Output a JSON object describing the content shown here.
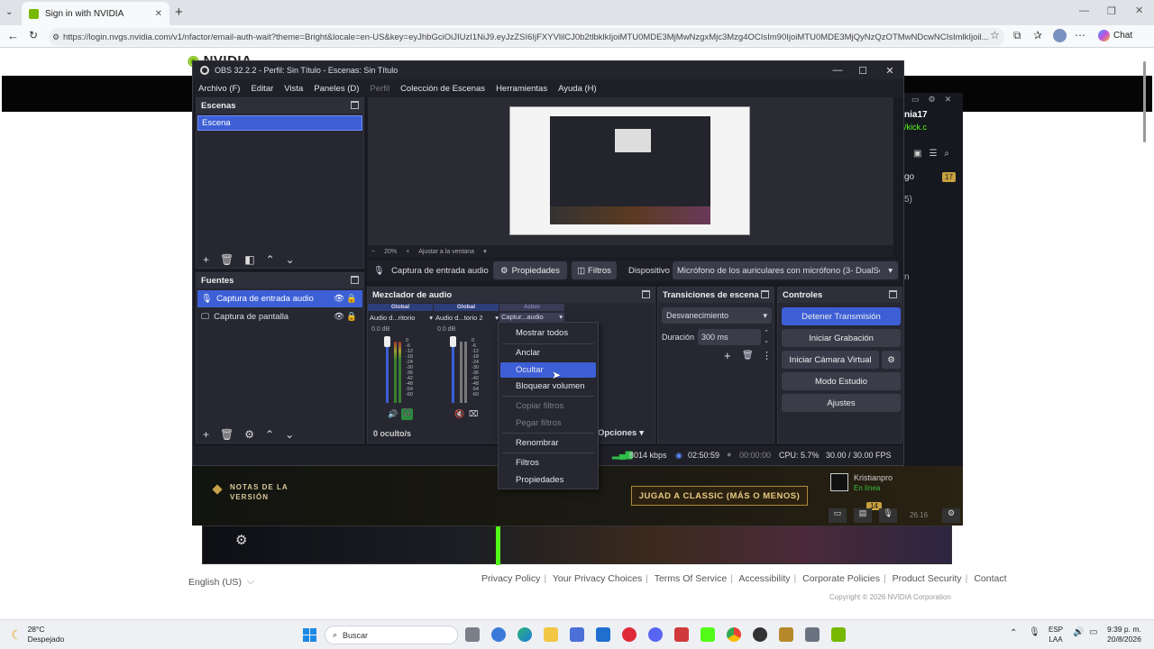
{
  "browser": {
    "tab_title": "Sign in with NVIDIA",
    "url": "https://login.nvgs.nvidia.com/v1/nfactor/email-auth-wait?theme=Bright&locale=en-US&key=eyJhbGciOiJIUzI1NiJ9.eyJzZSI6IjFXYVlilCJ0b2tlbklkIjoiMTU0MDE3MjMwNzgxMjc3Mzg4OCIsIm90IjoiMTU0MDE3MjQyNzQzOTMwNDcwNCIsImlkIjoil...",
    "chat_label": "Chat",
    "accent": "#76b900"
  },
  "page": {
    "logo_text": "NVIDIA",
    "side_user": "nia17",
    "side_link": "/kick.c",
    "side_go": "go",
    "side_badge": "17",
    "side_num": "5)",
    "side_n": "n",
    "game_notes": "NOTAS DE LA VERSIÓN",
    "game_cta": "JUGAD A CLASSIC (MÁS O MENOS)",
    "friend_name": "Kristianpro",
    "friend_status": "En línea",
    "friend_badge": "14",
    "friend_time": "26.16",
    "language": "English (US)",
    "footer_links": [
      "Privacy Policy",
      "Your Privacy Choices",
      "Terms Of Service",
      "Accessibility",
      "Corporate Policies",
      "Product Security",
      "Contact"
    ],
    "copyright": "Copyright © 2026 NVIDIA Corporation"
  },
  "obs": {
    "title": "OBS 32.2.2 - Perfil: Sin Título - Escenas: Sin Título",
    "menu": [
      "Archivo (F)",
      "Editar",
      "Vista",
      "Paneles (D)",
      "Perfil",
      "Colección de Escenas",
      "Herramientas",
      "Ayuda (H)"
    ],
    "scenes_header": "Escenas",
    "scene_item": "Escena",
    "sources_header": "Fuentes",
    "sources": [
      "Captura de entrada audio",
      "Captura de pantalla"
    ],
    "zoom": "20%",
    "fit_label": "Ajustar a la ventana",
    "source_toolbar": {
      "name": "Captura de entrada audio",
      "props": "Propiedades",
      "filters": "Filtros",
      "device_label": "Dispositivo",
      "device_value": "Micrófono de los auriculares con micrófono (3- DualSense"
    },
    "mixer": {
      "header": "Mezclador de audio",
      "tags": [
        "Global",
        "Global",
        "Activo"
      ],
      "channels": [
        "Audio d...ritorio",
        "Audio d...torio 2",
        "Captur...audio"
      ],
      "db": [
        "0.0 dB",
        "0.0 dB"
      ],
      "scale": [
        "0",
        "-6",
        "-12",
        "-18",
        "-24",
        "-30",
        "-36",
        "-42",
        "-48",
        "-54",
        "-60"
      ],
      "hidden": "0 oculto/s",
      "options": "Opciones"
    },
    "transitions": {
      "header": "Transiciones de escena",
      "type": "Desvanecimiento",
      "duration_label": "Duración",
      "duration_value": "300 ms"
    },
    "controls": {
      "header": "Controles",
      "buttons": [
        "Detener Transmisión",
        "Iniciar Grabación",
        "Iniciar Cámara Virtual",
        "Modo Estudio",
        "Ajustes"
      ]
    },
    "status": {
      "bitrate": "8014 kbps",
      "stream_time": "02:50:59",
      "rec_time": "00:00:00",
      "cpu": "CPU: 5.7%",
      "fps": "30.00 / 30.00 FPS"
    },
    "context_menu": [
      "Mostrar todos",
      "Anclar",
      "Ocultar",
      "Bloquear volumen",
      "Copiar filtros",
      "Pegar filtros",
      "Renombrar",
      "Filtros",
      "Propiedades"
    ],
    "context_highlight": "Ocultar"
  },
  "taskbar": {
    "weather_temp": "28°C",
    "weather_desc": "Despejado",
    "search_placeholder": "Buscar",
    "lang": "ESP",
    "lang2": "LAA",
    "time": "9:39 p. m.",
    "date": "20/8/2026"
  }
}
